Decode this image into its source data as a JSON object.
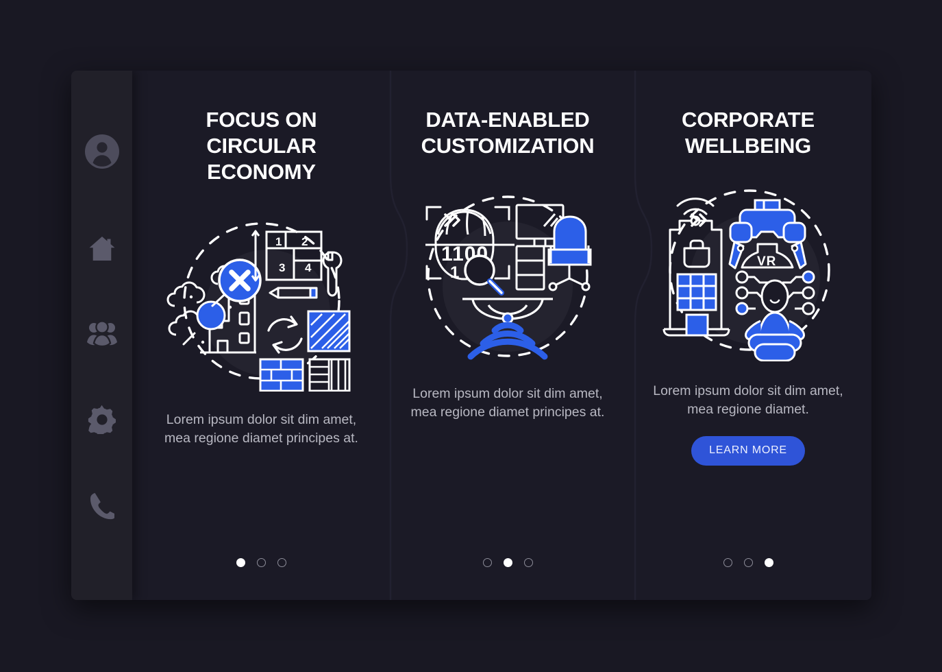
{
  "meta": {
    "background_color": "#191823",
    "card_color": "#1b1a26",
    "sidebar_color": "#212029",
    "accent_blue": "#2f54d8",
    "illustration_blue": "#2c5fe8",
    "text_primary": "#ffffff",
    "text_secondary": "#b8b8c2",
    "icon_muted": "#5b5a6b"
  },
  "sidebar": {
    "items": [
      {
        "icon": "user-avatar-icon",
        "label": "Profile"
      },
      {
        "icon": "home-icon",
        "label": "Home"
      },
      {
        "icon": "people-group-icon",
        "label": "Team"
      },
      {
        "icon": "gear-icon",
        "label": "Settings"
      },
      {
        "icon": "phone-icon",
        "label": "Contact"
      }
    ]
  },
  "separators": [
    {
      "icon": "double-chevron-right-icon",
      "glyph": "»"
    },
    {
      "icon": "double-chevron-right-icon",
      "glyph": "»"
    }
  ],
  "panels": [
    {
      "title": "FOCUS ON CIRCULAR ECONOMY",
      "body": "Lorem ipsum dolor sit dim amet, mea regione diamet principes at.",
      "illustration": "circular-economy-illustration",
      "illustration_labels": [
        "1",
        "2",
        "3",
        "4"
      ],
      "cta": null,
      "dots": {
        "count": 3,
        "active_index": 0
      }
    },
    {
      "title": "DATA-ENABLED CUSTOMIZATION",
      "body": "Lorem ipsum dolor sit dim amet, mea regione diamet principes at.",
      "illustration": "data-customization-illustration",
      "illustration_labels": [
        "1100",
        "1"
      ],
      "cta": null,
      "dots": {
        "count": 3,
        "active_index": 1
      }
    },
    {
      "title": "CORPORATE WELLBEING",
      "body": "Lorem ipsum dolor sit dim amet, mea regione diamet.",
      "illustration": "corporate-wellbeing-illustration",
      "illustration_labels": [
        "VR"
      ],
      "cta": "LEARN MORE",
      "dots": {
        "count": 3,
        "active_index": 2
      }
    }
  ]
}
